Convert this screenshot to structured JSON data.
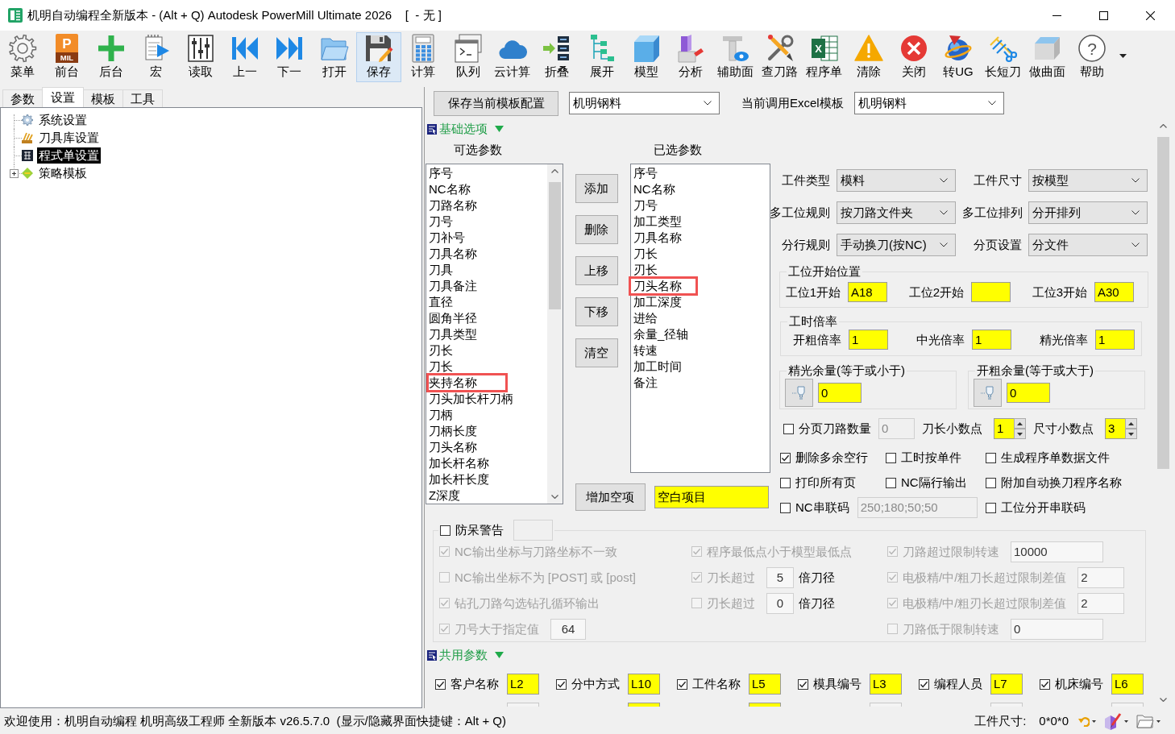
{
  "window": {
    "title": "机明自动编程全新版本 - (Alt + Q) Autodesk PowerMill Ultimate 2026    [  - 无 ]"
  },
  "toolbar": [
    {
      "label": "菜单",
      "kind": "gear",
      "highlighted": false
    },
    {
      "label": "前台",
      "kind": "app",
      "icon_text": "P",
      "icon_subtext": "MIL",
      "highlighted": false
    },
    {
      "label": "后台",
      "kind": "plus",
      "highlighted": false
    },
    {
      "label": "宏",
      "kind": "macro",
      "highlighted": false
    },
    {
      "label": "读取",
      "kind": "sliders",
      "highlighted": false
    },
    {
      "label": "上一",
      "kind": "prev",
      "highlighted": false
    },
    {
      "label": "下一",
      "kind": "next",
      "highlighted": false
    },
    {
      "label": "打开",
      "kind": "folder",
      "highlighted": false
    },
    {
      "label": "保存",
      "kind": "save",
      "highlighted": true
    },
    {
      "label": "计算",
      "kind": "calculator",
      "highlighted": false
    },
    {
      "label": "队列",
      "kind": "terminal",
      "highlighted": false
    },
    {
      "label": "云计算",
      "kind": "cloud",
      "highlighted": false
    },
    {
      "label": "折叠",
      "kind": "collapse",
      "highlighted": false
    },
    {
      "label": "展开",
      "kind": "expand",
      "highlighted": false
    },
    {
      "label": "模型",
      "kind": "cube",
      "highlighted": false
    },
    {
      "label": "分析",
      "kind": "analysis",
      "highlighted": false
    },
    {
      "label": "辅助面",
      "kind": "aux",
      "highlighted": false
    },
    {
      "label": "查刀路",
      "kind": "tools",
      "highlighted": false
    },
    {
      "label": "程序单",
      "kind": "sheet",
      "icon_text": "X",
      "highlighted": false
    },
    {
      "label": "清除",
      "kind": "warning",
      "highlighted": false
    },
    {
      "label": "关闭",
      "kind": "close",
      "highlighted": false
    },
    {
      "label": "转UG",
      "kind": "globe",
      "highlighted": false
    },
    {
      "label": "长短刀",
      "kind": "cutter",
      "highlighted": false
    },
    {
      "label": "做曲面",
      "kind": "surface",
      "highlighted": false
    },
    {
      "label": "帮助",
      "kind": "help",
      "icon_text": "?",
      "highlighted": false
    }
  ],
  "left_panel": {
    "tabs": [
      {
        "label": "参数",
        "selected": false
      },
      {
        "label": "设置",
        "selected": true
      },
      {
        "label": "模板",
        "selected": false
      },
      {
        "label": "工具",
        "selected": false
      }
    ],
    "tree": [
      {
        "label": "系统设置",
        "kind": "gear",
        "selected": false
      },
      {
        "label": "刀具库设置",
        "kind": "brush",
        "selected": false
      },
      {
        "label": "程式单设置",
        "kind": "grid",
        "selected": true
      },
      {
        "label": "策略模板",
        "kind": "leaf",
        "selected": false,
        "expanded": false
      }
    ]
  },
  "template_bar": {
    "save_button": "保存当前模板配置",
    "template": "机明钢料",
    "excel_label": "当前调用Excel模板",
    "excel_template": "机明钢料"
  },
  "basic": {
    "title": "基础选项",
    "expanded": true,
    "available": {
      "heading": "可选参数",
      "items": [
        {
          "label": "序号",
          "highlighted": false
        },
        {
          "label": "NC名称",
          "highlighted": false
        },
        {
          "label": "刀路名称",
          "highlighted": false
        },
        {
          "label": "刀号",
          "highlighted": false
        },
        {
          "label": "刀补号",
          "highlighted": false
        },
        {
          "label": "刀具名称",
          "highlighted": false
        },
        {
          "label": "刀具",
          "highlighted": false
        },
        {
          "label": "刀具备注",
          "highlighted": false
        },
        {
          "label": "直径",
          "highlighted": false
        },
        {
          "label": "圆角半径",
          "highlighted": false
        },
        {
          "label": "刀具类型",
          "highlighted": false
        },
        {
          "label": "刃长",
          "highlighted": false
        },
        {
          "label": "刀长",
          "highlighted": false
        },
        {
          "label": "夹持名称",
          "highlighted": true
        },
        {
          "label": "刀头加长杆刀柄",
          "highlighted": false
        },
        {
          "label": "刀柄",
          "highlighted": false
        },
        {
          "label": "刀柄长度",
          "highlighted": false
        },
        {
          "label": "刀头名称",
          "highlighted": false
        },
        {
          "label": "加长杆名称",
          "highlighted": false
        },
        {
          "label": "加长杆长度",
          "highlighted": false
        },
        {
          "label": "Z深度",
          "highlighted": false
        }
      ]
    },
    "list_buttons": [
      "添加",
      "删除",
      "上移",
      "下移",
      "清空"
    ],
    "chosen": {
      "heading": "已选参数",
      "items": [
        {
          "label": "序号",
          "highlighted": false
        },
        {
          "label": "NC名称",
          "highlighted": false
        },
        {
          "label": "刀号",
          "highlighted": false
        },
        {
          "label": "加工类型",
          "highlighted": false
        },
        {
          "label": "刀具名称",
          "highlighted": false
        },
        {
          "label": "刀长",
          "highlighted": false
        },
        {
          "label": "刃长",
          "highlighted": false
        },
        {
          "label": "刀头名称",
          "highlighted": true
        },
        {
          "label": "加工深度",
          "highlighted": false
        },
        {
          "label": "进给",
          "highlighted": false
        },
        {
          "label": "余量_径轴",
          "highlighted": false
        },
        {
          "label": "转速",
          "highlighted": false
        },
        {
          "label": "加工时间",
          "highlighted": false
        },
        {
          "label": "备注",
          "highlighted": false
        }
      ]
    },
    "add_blank": {
      "button": "增加空项",
      "value": "空白项目"
    },
    "selects": [
      {
        "label": "工件类型",
        "value": "模料"
      },
      {
        "label": "工件尺寸",
        "value": "按模型"
      },
      {
        "label": "多工位规则",
        "value": "按刀路文件夹"
      },
      {
        "label": "多工位排列",
        "value": "分开排列"
      },
      {
        "label": "分行规则",
        "value": "手动换刀(按NC)"
      },
      {
        "label": "分页设置",
        "value": "分文件"
      }
    ],
    "start_positions": {
      "title": "工位开始位置",
      "fields": [
        {
          "label": "工位1开始",
          "value": "A18"
        },
        {
          "label": "工位2开始"
        },
        {
          "label": "工位3开始",
          "value": "A30"
        }
      ]
    },
    "time_rates": {
      "title": "工时倍率",
      "fields": [
        {
          "label": "开粗倍率",
          "value": "1"
        },
        {
          "label": "中光倍率",
          "value": "1"
        },
        {
          "label": "精光倍率",
          "value": "1"
        }
      ]
    },
    "allowances": [
      {
        "title": "精光余量(等于或小于)",
        "value": "0"
      },
      {
        "title": "开粗余量(等于或大于)",
        "value": "0"
      }
    ],
    "page_split": {
      "label": "分页刀路数量",
      "checked": false,
      "value": "0"
    },
    "decimals": [
      {
        "label": "刀长小数点",
        "value": "1"
      },
      {
        "label": "尺寸小数点",
        "value": "3"
      }
    ],
    "options": [
      {
        "label": "删除多余空行",
        "checked": true
      },
      {
        "label": "工时按单件",
        "checked": false
      },
      {
        "label": "生成程序单数据文件",
        "checked": false
      },
      {
        "label": "打印所有页",
        "checked": false
      },
      {
        "label": "NC隔行输出",
        "checked": false
      },
      {
        "label": "附加自动换刀程序名称",
        "checked": false
      },
      {
        "label": "NC串联码",
        "checked": false,
        "value": "250;180;50;50"
      },
      {
        "label": "工位分开串联码",
        "checked": false
      }
    ]
  },
  "safety": {
    "label": "防呆警告",
    "checked": false,
    "columns": [
      [
        {
          "label": "NC输出坐标与刀路坐标不一致",
          "checked": true
        },
        {
          "label": "NC输出坐标不为 [POST] 或 [post]",
          "checked": false
        },
        {
          "label": "钻孔刀路勾选钻孔循环输出",
          "checked": true
        },
        {
          "label": "刀号大于指定值",
          "checked": true,
          "value": "64"
        }
      ],
      [
        {
          "label": "程序最低点小于模型最低点",
          "checked": true
        },
        {
          "label": "刀长超过",
          "checked": true,
          "value": "5",
          "suffix": "倍刀径"
        },
        {
          "label": "刃长超过",
          "checked": false,
          "value": "0",
          "suffix": "倍刀径"
        }
      ],
      [
        {
          "label": "刀路超过限制转速",
          "checked": true,
          "value": "10000"
        },
        {
          "label": "电极精/中/粗刀长超过限制差值",
          "checked": true,
          "value": "2"
        },
        {
          "label": "电极精/中/粗刃长超过限制差值",
          "checked": true,
          "value": "2"
        },
        {
          "label": "刀路低于限制转速",
          "checked": false,
          "value": "0"
        }
      ]
    ]
  },
  "common": {
    "title": "共用参数",
    "expanded": true,
    "fields": [
      {
        "label": "客户名称",
        "checked": true,
        "value": "L2"
      },
      {
        "label": "分中方式",
        "checked": true,
        "value": "L10"
      },
      {
        "label": "工件名称",
        "checked": true,
        "value": "L5"
      },
      {
        "label": "模具编号",
        "checked": true,
        "value": "L3"
      },
      {
        "label": "编程人员",
        "checked": true,
        "value": "L7"
      },
      {
        "label": "机床编号",
        "checked": true,
        "value": "L6"
      }
    ],
    "next_row": [
      {
        "highlighted": false
      },
      {
        "highlighted": true
      },
      {
        "highlighted": true
      },
      {
        "highlighted": false
      },
      {
        "highlighted": false
      },
      {
        "highlighted": false
      }
    ]
  },
  "status_bar": {
    "message": "欢迎使用：机明自动编程 机明高级工程师 全新版本 v26.5.7.0  (显示/隐藏界面快捷键：Alt + Q)",
    "size_label": "工件尺寸:",
    "size_value": "0*0*0"
  }
}
